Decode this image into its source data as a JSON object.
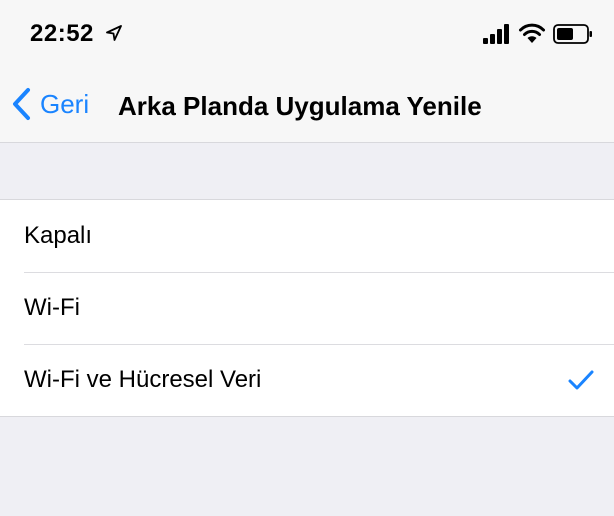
{
  "status_bar": {
    "time": "22:52",
    "icons": [
      "location-arrow-icon",
      "cellular-signal-icon",
      "wifi-icon",
      "battery-icon"
    ]
  },
  "nav": {
    "back_label": "Geri",
    "title": "Arka Planda Uygulama Yenile"
  },
  "options": [
    {
      "label": "Kapalı",
      "selected": false
    },
    {
      "label": "Wi-Fi",
      "selected": false
    },
    {
      "label": "Wi-Fi ve Hücresel Veri",
      "selected": true
    }
  ],
  "colors": {
    "accent": "#1a84ff",
    "background": "#efeff4",
    "bar": "#f7f7f7",
    "cell": "#ffffff"
  }
}
